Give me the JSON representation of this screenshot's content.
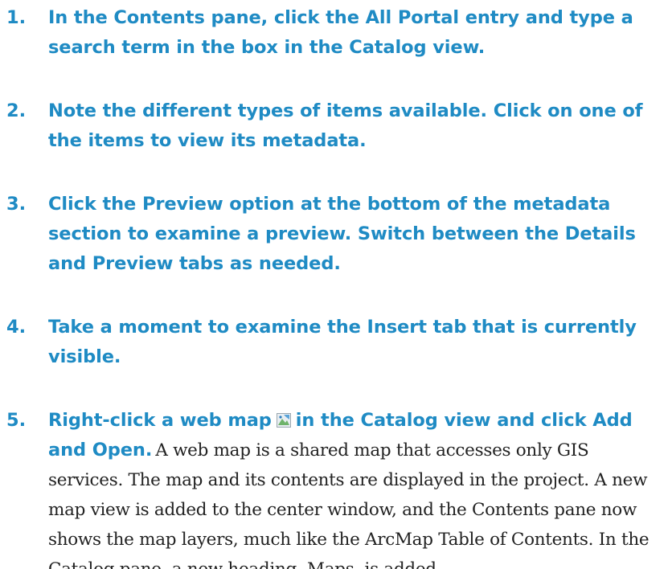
{
  "steps": [
    {
      "number": "1.",
      "text": "In the Contents pane, click the All Portal entry and type a search term in the box in the Catalog view."
    },
    {
      "number": "2.",
      "text": "Note the different types of items available. Click on one of the items to view its metadata."
    },
    {
      "number": "3.",
      "text": "Click the Preview option at the bottom of the metadata section to examine a preview. Switch between the Details and Preview tabs as needed."
    },
    {
      "number": "4.",
      "text": "Take a moment to examine the Insert tab that is currently visible."
    },
    {
      "number": "5.",
      "text_before_icon": "Right-click a web map",
      "icon": "web-map-icon",
      "text_after_icon": "in the Catalog view and click Add and Open.",
      "description": "A web map is a shared map that accesses only GIS services. The map and its contents are displayed in the project. A new map view is added to the center window, and the Contents pane now shows the map layers, much like the ArcMap Table of Contents. In the Catalog pane, a new heading, Maps, is added."
    }
  ],
  "colors": {
    "instruction": "#1f8bc4",
    "body_text": "#222222"
  }
}
